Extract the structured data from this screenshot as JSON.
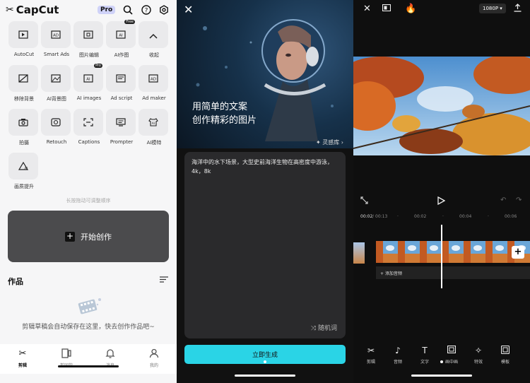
{
  "home": {
    "brand": "CapCut",
    "pro_badge": "Pro",
    "tools_row1": [
      {
        "label": "AutoCut"
      },
      {
        "label": "Smart Ads"
      },
      {
        "label": "图片编辑"
      },
      {
        "label": "AI作图",
        "badge": "Free"
      },
      {
        "label": "收起"
      }
    ],
    "tools_row2": [
      {
        "label": "移除背景"
      },
      {
        "label": "AI背景图"
      },
      {
        "label": "AI images",
        "badge": "Pro"
      },
      {
        "label": "Ad script"
      },
      {
        "label": "Ad maker"
      }
    ],
    "tools_row3": [
      {
        "label": "拍摄"
      },
      {
        "label": "Retouch"
      },
      {
        "label": "Captions"
      },
      {
        "label": "Prompter"
      },
      {
        "label": "AI模特"
      }
    ],
    "tools_row4": [
      {
        "label": "画质提升"
      }
    ],
    "hint": "长按拖动可调整顺序",
    "create_label": "开始创作",
    "works_title": "作品",
    "empty_text": "剪辑草稿会自动保存在这里，快去创作作品吧~",
    "tabs": [
      {
        "label": "剪辑",
        "icon": "scissors-icon",
        "active": true
      },
      {
        "label": "剪同款",
        "icon": "template-icon",
        "active": false
      },
      {
        "label": "消息",
        "icon": "bell-icon",
        "active": false
      },
      {
        "label": "我的",
        "icon": "profile-icon",
        "active": false
      }
    ]
  },
  "ai_image": {
    "hero_title_line1": "用简单的文案",
    "hero_title_line2": "创作精彩的图片",
    "inspiration_label": "灵感库",
    "prompt_text": "海洋中的水下场景，大型史前海洋生物在高密度中游泳，4k，8k",
    "random_label": "随机词",
    "generate_label": "立即生成"
  },
  "editor": {
    "resolution": "1080P",
    "current_time": "00:02",
    "total_time": "00:13",
    "ticks": [
      "00:02",
      "00:04",
      "00:06"
    ],
    "add_audio_label": "添加音频",
    "toolbar": [
      {
        "label": "剪辑",
        "icon": "scissors-icon"
      },
      {
        "label": "音频",
        "icon": "music-icon"
      },
      {
        "label": "文字",
        "icon": "text-icon"
      },
      {
        "label": "画中画",
        "icon": "pip-icon"
      },
      {
        "label": "特效",
        "icon": "effects-icon"
      },
      {
        "label": "模板",
        "icon": "template-icon"
      }
    ]
  }
}
